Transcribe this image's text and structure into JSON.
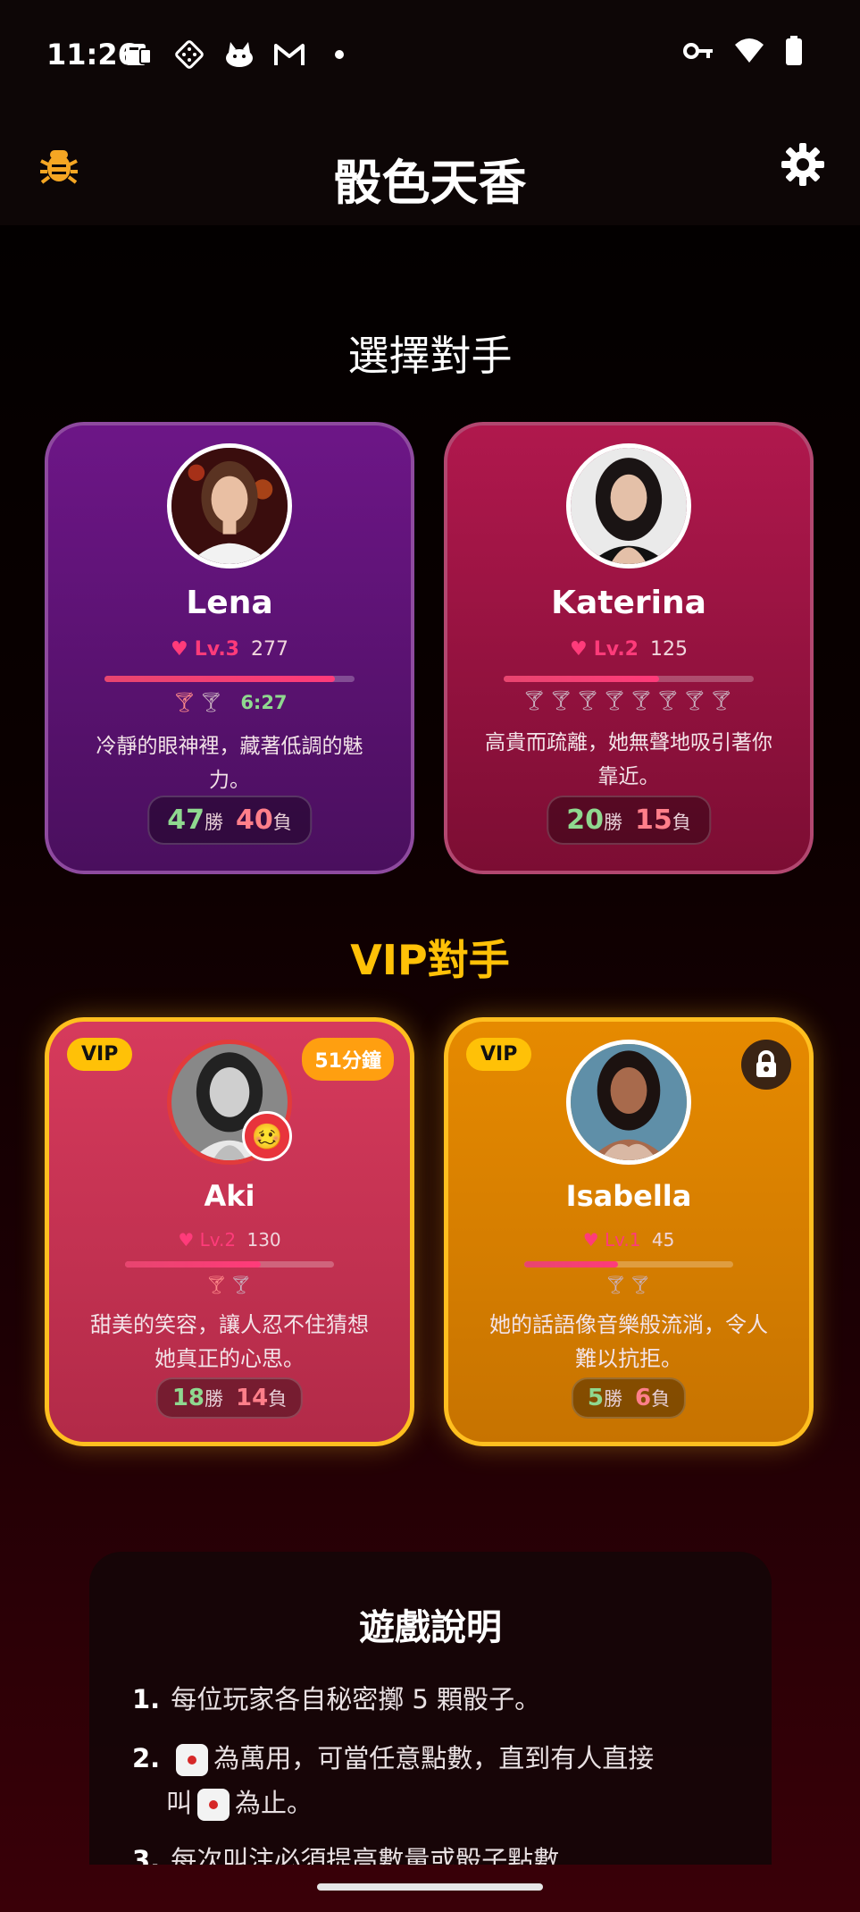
{
  "status": {
    "time": "11:26",
    "icons": [
      "tablet-icon",
      "dice-icon",
      "cat-icon",
      "gmail-icon",
      "dot-icon",
      "key-icon",
      "wifi-icon",
      "battery-icon"
    ]
  },
  "appbar": {
    "title": "骰色天香",
    "left_icon": "bug-icon",
    "right_icon": "gear-icon"
  },
  "sections": {
    "choose": "選擇對手",
    "vip": "VIP對手"
  },
  "opponents": [
    {
      "name": "Lena",
      "level": "Lv.3",
      "points": "277",
      "progress": 0.92,
      "timer": "6:27",
      "description": "冷靜的眼神裡，藏著低調的魅力。",
      "wins": "47",
      "win_unit": "勝",
      "losses": "40",
      "loss_unit": "負",
      "color": "#6d1687"
    },
    {
      "name": "Katerina",
      "level": "Lv.2",
      "points": "125",
      "progress": 0.62,
      "description": "高貴而疏離，她無聲地吸引著你靠近。",
      "wins": "20",
      "win_unit": "勝",
      "losses": "15",
      "loss_unit": "負",
      "color": "#b0184d"
    }
  ],
  "vip_opponents": [
    {
      "badge": "VIP",
      "timer_badge": "51分鐘",
      "emoji": "🥴",
      "name": "Aki",
      "level": "Lv.2",
      "points": "130",
      "progress": 0.65,
      "description": "甜美的笑容，讓人忍不住猜想她真正的心思。",
      "wins": "18",
      "win_unit": "勝",
      "losses": "14",
      "loss_unit": "負",
      "color": "#d63a5c"
    },
    {
      "badge": "VIP",
      "locked": true,
      "name": "Isabella",
      "level": "Lv.1",
      "points": "45",
      "progress": 0.45,
      "description": "她的話語像音樂般流淌，令人難以抗拒。",
      "wins": "5",
      "win_unit": "勝",
      "losses": "6",
      "loss_unit": "負",
      "color": "#e68a00"
    }
  ],
  "rules": {
    "title": "遊戲說明",
    "items": [
      {
        "n": "1.",
        "text": "每位玩家各自秘密擲 5 顆骰子。"
      },
      {
        "n": "2.",
        "text_a": "為萬用，可當任意點數，直到有人直接",
        "text_b": "叫",
        "text_c": "為止。"
      },
      {
        "n": "3.",
        "text": "每次叫注必須提高數量或骰子點數"
      }
    ]
  }
}
